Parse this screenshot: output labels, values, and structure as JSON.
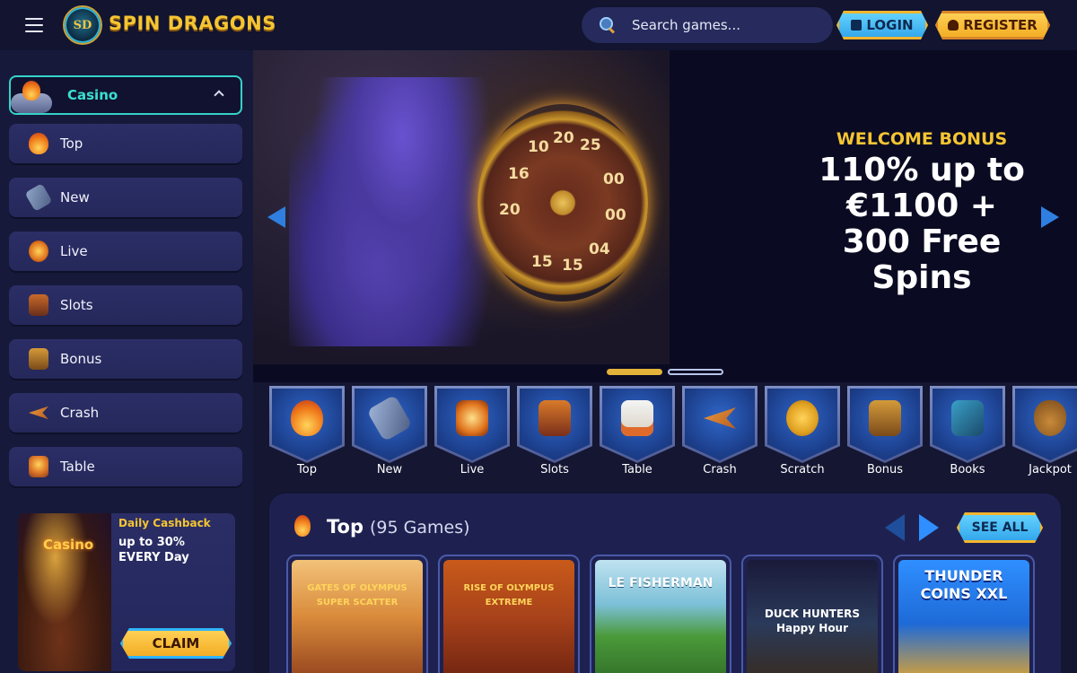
{
  "header": {
    "logo_mark": "SD",
    "logo_text": "SPIN DRAGONS",
    "search_placeholder": "Search games...",
    "login_label": "LOGIN",
    "register_label": "REGISTER"
  },
  "sidebar": {
    "section_label": "Casino",
    "items": [
      {
        "label": "Top",
        "icon": "flame-icon"
      },
      {
        "label": "New",
        "icon": "cannon-icon"
      },
      {
        "label": "Live",
        "icon": "cards-icon"
      },
      {
        "label": "Slots",
        "icon": "slot-machine-icon"
      },
      {
        "label": "Bonus",
        "icon": "treasure-chest-icon"
      },
      {
        "label": "Crash",
        "icon": "plane-icon"
      },
      {
        "label": "Table",
        "icon": "table-game-icon"
      }
    ],
    "promo": {
      "image_sign": "Casino",
      "title": "Daily Cashback",
      "description": "up to 30% EVERY Day",
      "button_label": "CLAIM"
    }
  },
  "hero": {
    "kicker": "WELCOME BONUS",
    "headline": "110% up to €1100 + 300 Free Spins",
    "wheel_numbers": [
      "10",
      "20",
      "25",
      "16",
      "00",
      "20",
      "15",
      "15",
      "04",
      "00"
    ],
    "slide_count": 2,
    "active_slide": 1
  },
  "categories": [
    {
      "label": "Top",
      "icon": "flame-icon"
    },
    {
      "label": "New",
      "icon": "cannon-icon"
    },
    {
      "label": "Live",
      "icon": "cards-icon"
    },
    {
      "label": "Slots",
      "icon": "slot-machine-icon"
    },
    {
      "label": "Table",
      "icon": "table-game-icon"
    },
    {
      "label": "Crash",
      "icon": "plane-icon"
    },
    {
      "label": "Scratch",
      "icon": "scratch-coin-icon"
    },
    {
      "label": "Bonus",
      "icon": "treasure-chest-icon"
    },
    {
      "label": "Books",
      "icon": "book-icon"
    },
    {
      "label": "Jackpot",
      "icon": "money-bag-icon"
    }
  ],
  "games_section": {
    "title": "Top",
    "count": "(95 Games)",
    "see_all_label": "SEE ALL",
    "games": [
      {
        "title": "GATES OF OLYMPUS SUPER SCATTER"
      },
      {
        "title": "RISE OF OLYMPUS EXTREME"
      },
      {
        "title": "LE FISHERMAN"
      },
      {
        "title": "DUCK HUNTERS Happy Hour"
      },
      {
        "title": "THUNDER COINS XXL"
      }
    ]
  },
  "colors": {
    "background": "#141632",
    "accent_gold": "#f5c532",
    "accent_teal": "#39e0d1",
    "accent_blue": "#2f8fff"
  }
}
